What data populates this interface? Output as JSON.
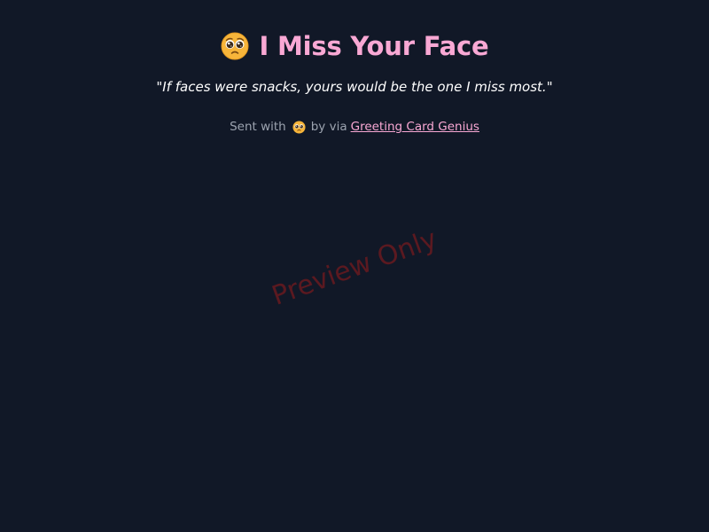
{
  "card": {
    "emoji_icon": "pleading-face-icon",
    "title": "I Miss Your Face",
    "quote": "\"If faces were snacks, yours would be the one I miss most.\"",
    "footer": {
      "sent_with": "Sent with",
      "emoji_icon": "pleading-face-icon",
      "by_via": "by via",
      "link_text": "Greeting Card Genius"
    }
  },
  "watermark": "Preview Only",
  "colors": {
    "background": "#111827",
    "title": "#f9a8d4",
    "quote": "#ffffff",
    "footer_text": "#9ca3af",
    "link": "#f9a8d4",
    "watermark": "#991b1b"
  }
}
